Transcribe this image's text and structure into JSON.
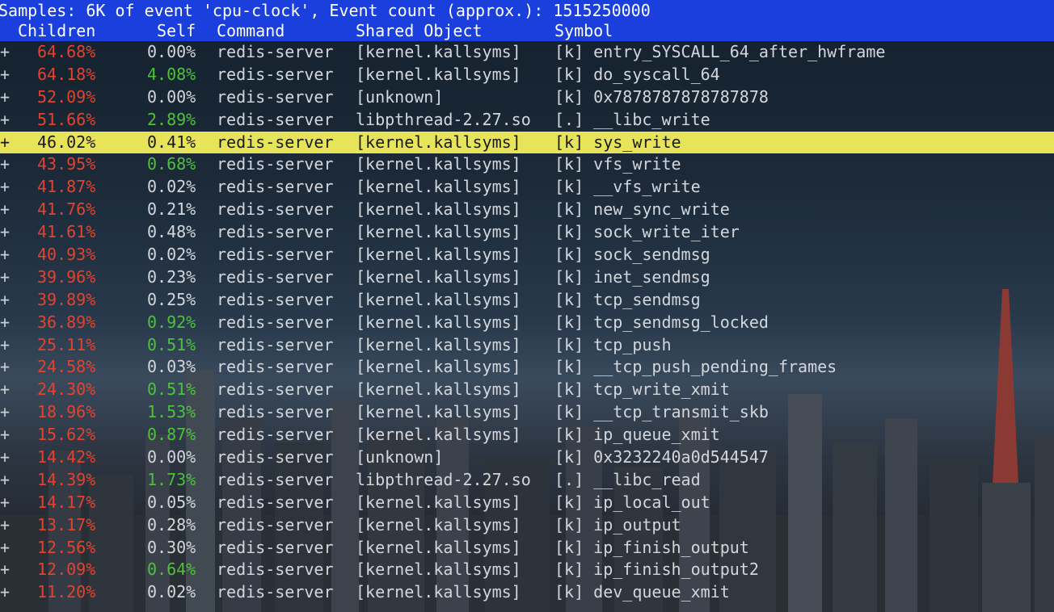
{
  "header": {
    "summary": "Samples: 6K of event 'cpu-clock', Event count (approx.): 1515250000",
    "columns": {
      "children": "Children",
      "self": "Self",
      "command": "Command",
      "shared_object": "Shared Object",
      "symbol": "Symbol"
    }
  },
  "colors": {
    "header_bg": "#1a3fdd",
    "selected_bg": "#e8e45a",
    "hot_red": "#e2432f",
    "green": "#4cc23a"
  },
  "selected_row_index": 4,
  "rows": [
    {
      "expand": "+",
      "children": "64.68%",
      "self": "0.00%",
      "self_color": "plain",
      "command": "redis-server",
      "shared_object": "[kernel.kallsyms]",
      "symbol": "[k] entry_SYSCALL_64_after_hwframe"
    },
    {
      "expand": "+",
      "children": "64.18%",
      "self": "4.08%",
      "self_color": "warm",
      "command": "redis-server",
      "shared_object": "[kernel.kallsyms]",
      "symbol": "[k] do_syscall_64"
    },
    {
      "expand": "+",
      "children": "52.09%",
      "self": "0.00%",
      "self_color": "plain",
      "command": "redis-server",
      "shared_object": "[unknown]",
      "symbol": "[k] 0x7878787878787878"
    },
    {
      "expand": "+",
      "children": "51.66%",
      "self": "2.89%",
      "self_color": "warm",
      "command": "redis-server",
      "shared_object": "libpthread-2.27.so",
      "symbol": "[.] __libc_write"
    },
    {
      "expand": "+",
      "children": "46.02%",
      "self": "0.41%",
      "self_color": "plain",
      "command": "redis-server",
      "shared_object": "[kernel.kallsyms]",
      "symbol": "[k] sys_write"
    },
    {
      "expand": "+",
      "children": "43.95%",
      "self": "0.68%",
      "self_color": "warm",
      "command": "redis-server",
      "shared_object": "[kernel.kallsyms]",
      "symbol": "[k] vfs_write"
    },
    {
      "expand": "+",
      "children": "41.87%",
      "self": "0.02%",
      "self_color": "plain",
      "command": "redis-server",
      "shared_object": "[kernel.kallsyms]",
      "symbol": "[k] __vfs_write"
    },
    {
      "expand": "+",
      "children": "41.76%",
      "self": "0.21%",
      "self_color": "plain",
      "command": "redis-server",
      "shared_object": "[kernel.kallsyms]",
      "symbol": "[k] new_sync_write"
    },
    {
      "expand": "+",
      "children": "41.61%",
      "self": "0.48%",
      "self_color": "plain",
      "command": "redis-server",
      "shared_object": "[kernel.kallsyms]",
      "symbol": "[k] sock_write_iter"
    },
    {
      "expand": "+",
      "children": "40.93%",
      "self": "0.02%",
      "self_color": "plain",
      "command": "redis-server",
      "shared_object": "[kernel.kallsyms]",
      "symbol": "[k] sock_sendmsg"
    },
    {
      "expand": "+",
      "children": "39.96%",
      "self": "0.23%",
      "self_color": "plain",
      "command": "redis-server",
      "shared_object": "[kernel.kallsyms]",
      "symbol": "[k] inet_sendmsg"
    },
    {
      "expand": "+",
      "children": "39.89%",
      "self": "0.25%",
      "self_color": "plain",
      "command": "redis-server",
      "shared_object": "[kernel.kallsyms]",
      "symbol": "[k] tcp_sendmsg"
    },
    {
      "expand": "+",
      "children": "36.89%",
      "self": "0.92%",
      "self_color": "warm",
      "command": "redis-server",
      "shared_object": "[kernel.kallsyms]",
      "symbol": "[k] tcp_sendmsg_locked"
    },
    {
      "expand": "+",
      "children": "25.11%",
      "self": "0.51%",
      "self_color": "warm",
      "command": "redis-server",
      "shared_object": "[kernel.kallsyms]",
      "symbol": "[k] tcp_push"
    },
    {
      "expand": "+",
      "children": "24.58%",
      "self": "0.03%",
      "self_color": "plain",
      "command": "redis-server",
      "shared_object": "[kernel.kallsyms]",
      "symbol": "[k] __tcp_push_pending_frames"
    },
    {
      "expand": "+",
      "children": "24.30%",
      "self": "0.51%",
      "self_color": "warm",
      "command": "redis-server",
      "shared_object": "[kernel.kallsyms]",
      "symbol": "[k] tcp_write_xmit"
    },
    {
      "expand": "+",
      "children": "18.96%",
      "self": "1.53%",
      "self_color": "warm",
      "command": "redis-server",
      "shared_object": "[kernel.kallsyms]",
      "symbol": "[k] __tcp_transmit_skb"
    },
    {
      "expand": "+",
      "children": "15.62%",
      "self": "0.87%",
      "self_color": "warm",
      "command": "redis-server",
      "shared_object": "[kernel.kallsyms]",
      "symbol": "[k] ip_queue_xmit"
    },
    {
      "expand": "+",
      "children": "14.42%",
      "self": "0.00%",
      "self_color": "plain",
      "command": "redis-server",
      "shared_object": "[unknown]",
      "symbol": "[k] 0x3232240a0d544547"
    },
    {
      "expand": "+",
      "children": "14.39%",
      "self": "1.73%",
      "self_color": "warm",
      "command": "redis-server",
      "shared_object": "libpthread-2.27.so",
      "symbol": "[.] __libc_read"
    },
    {
      "expand": "+",
      "children": "14.17%",
      "self": "0.05%",
      "self_color": "plain",
      "command": "redis-server",
      "shared_object": "[kernel.kallsyms]",
      "symbol": "[k] ip_local_out"
    },
    {
      "expand": "+",
      "children": "13.17%",
      "self": "0.28%",
      "self_color": "plain",
      "command": "redis-server",
      "shared_object": "[kernel.kallsyms]",
      "symbol": "[k] ip_output"
    },
    {
      "expand": "+",
      "children": "12.56%",
      "self": "0.30%",
      "self_color": "plain",
      "command": "redis-server",
      "shared_object": "[kernel.kallsyms]",
      "symbol": "[k] ip_finish_output"
    },
    {
      "expand": "+",
      "children": "12.09%",
      "self": "0.64%",
      "self_color": "warm",
      "command": "redis-server",
      "shared_object": "[kernel.kallsyms]",
      "symbol": "[k] ip_finish_output2"
    },
    {
      "expand": "+",
      "children": "11.20%",
      "self": "0.02%",
      "self_color": "plain",
      "command": "redis-server",
      "shared_object": "[kernel.kallsyms]",
      "symbol": "[k] dev_queue_xmit"
    }
  ]
}
